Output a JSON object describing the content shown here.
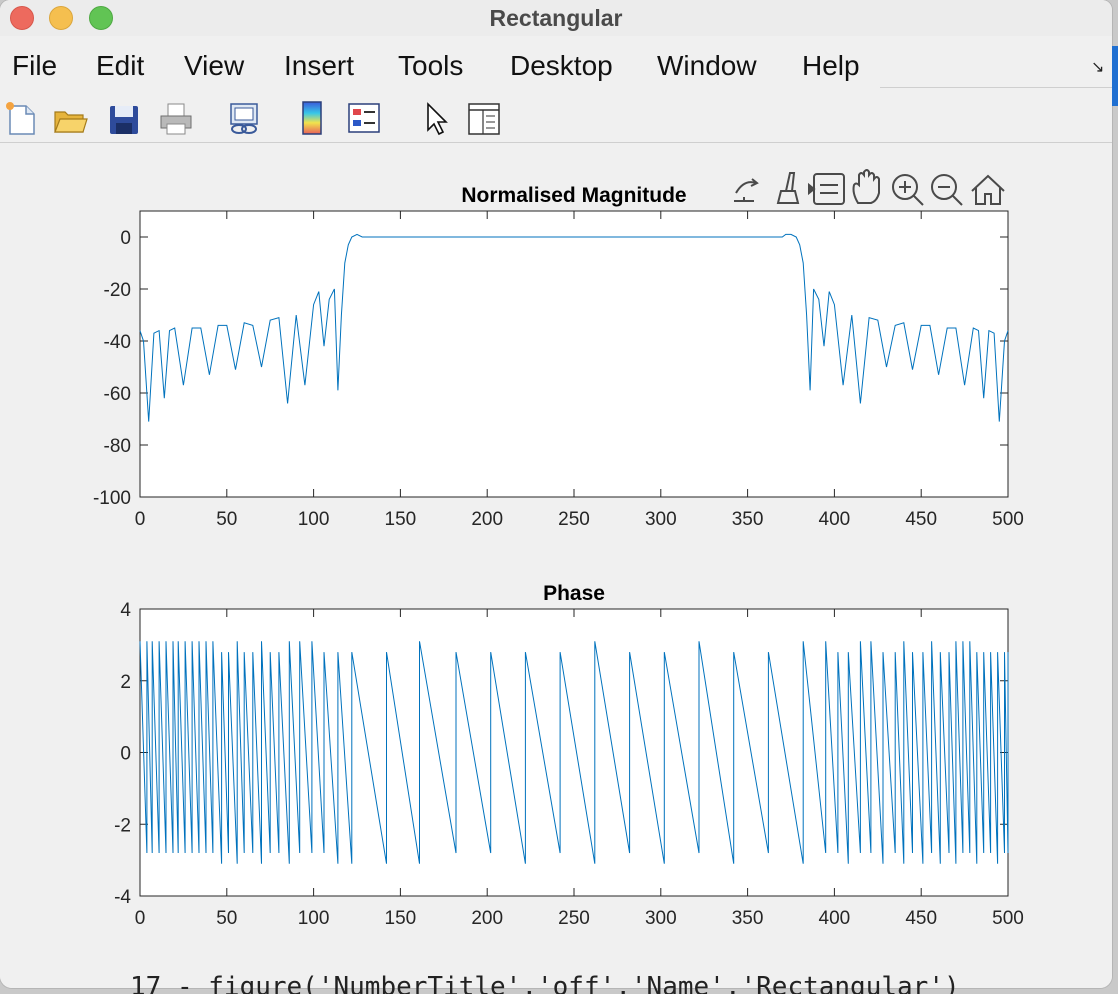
{
  "window": {
    "title": "Rectangular"
  },
  "menubar": {
    "items": [
      "File",
      "Edit",
      "View",
      "Insert",
      "Tools",
      "Desktop",
      "Window",
      "Help"
    ]
  },
  "toolbar": {
    "buttons": [
      "new-figure-icon",
      "open-file-icon",
      "save-icon",
      "print-icon",
      "link-plot-icon",
      "colorbar-icon",
      "legend-icon",
      "pointer-icon",
      "property-inspector-icon"
    ]
  },
  "axes_toolbar": {
    "buttons": [
      "export-icon",
      "brush-icon",
      "data-tips-icon",
      "pan-icon",
      "zoom-in-icon",
      "zoom-out-icon",
      "home-icon"
    ]
  },
  "background_code": "17 - figure('NumberTitle','off','Name','Rectangular')",
  "colors": {
    "line": "#0072bd"
  },
  "chart_data": [
    {
      "type": "line",
      "title": "Normalised Magnitude",
      "xlabel": "",
      "ylabel": "",
      "xlim": [
        0,
        500
      ],
      "ylim": [
        -100,
        10
      ],
      "xticks": [
        0,
        50,
        100,
        150,
        200,
        250,
        300,
        350,
        400,
        450,
        500
      ],
      "yticks": [
        0,
        -20,
        -40,
        -60,
        -80,
        -100
      ],
      "grid": false,
      "series": [
        {
          "description_of_shape": "",
          "x": [
            0,
            2,
            5,
            8,
            11,
            14,
            17,
            20,
            25,
            30,
            35,
            40,
            45,
            50,
            55,
            60,
            65,
            70,
            75,
            80,
            85,
            90,
            95,
            100,
            103,
            106,
            109,
            112,
            114,
            116,
            118,
            120,
            122,
            125,
            128,
            130,
            133,
            140,
            150,
            160,
            170,
            180,
            200,
            220,
            240,
            260,
            280,
            300,
            320,
            340,
            360,
            367,
            370,
            372,
            375,
            378,
            380,
            382,
            384,
            386,
            388,
            391,
            394,
            397,
            400,
            405,
            410,
            415,
            420,
            425,
            430,
            435,
            440,
            445,
            450,
            455,
            460,
            465,
            470,
            475,
            480,
            483,
            486,
            489,
            492,
            495,
            498,
            500
          ],
          "y": [
            -36,
            -40,
            -71,
            -37,
            -36,
            -62,
            -36,
            -35,
            -57,
            -35,
            -35,
            -53,
            -34,
            -34,
            -51,
            -33,
            -34,
            -50,
            -32,
            -31,
            -64,
            -30,
            -57,
            -26,
            -21,
            -42,
            -24,
            -20,
            -59,
            -30,
            -10,
            -3,
            0,
            1,
            0,
            0,
            0,
            0,
            0,
            0,
            0,
            0,
            0,
            0,
            0,
            0,
            0,
            0,
            0,
            0,
            0,
            0,
            0,
            1,
            1,
            0,
            -3,
            -10,
            -30,
            -59,
            -20,
            -24,
            -42,
            -21,
            -26,
            -57,
            -30,
            -64,
            -31,
            -32,
            -50,
            -34,
            -33,
            -51,
            -34,
            -34,
            -53,
            -35,
            -35,
            -57,
            -35,
            -36,
            -62,
            -36,
            -37,
            -71,
            -40,
            -36
          ]
        }
      ]
    },
    {
      "type": "line",
      "title": "Phase",
      "xlabel": "",
      "ylabel": "",
      "xlim": [
        0,
        500
      ],
      "ylim": [
        -4,
        4
      ],
      "xticks": [
        0,
        50,
        100,
        150,
        200,
        250,
        300,
        350,
        400,
        450,
        500
      ],
      "yticks": [
        4,
        2,
        0,
        -2,
        -4
      ],
      "grid": false,
      "series": [
        {
          "x": [
            0,
            4,
            7,
            11,
            15,
            19,
            22,
            26,
            30,
            34,
            38,
            42,
            47,
            51,
            56,
            60,
            65,
            70,
            75,
            80,
            86,
            92,
            99,
            106,
            114,
            122,
            142,
            161,
            182,
            202,
            222,
            242,
            262,
            282,
            302,
            322,
            342,
            362,
            382,
            395,
            402,
            408,
            415,
            421,
            428,
            435,
            440,
            445,
            451,
            456,
            461,
            466,
            470,
            474,
            478,
            482,
            486,
            490,
            494,
            498,
            500
          ],
          "top": [
            3.1,
            3.1,
            3.1,
            3.1,
            3.1,
            3.1,
            3.1,
            3.1,
            3.1,
            3.1,
            3.1,
            3.1,
            2.8,
            2.8,
            3.1,
            2.8,
            2.8,
            3.1,
            2.8,
            2.8,
            3.1,
            3.1,
            3.1,
            2.8,
            2.8,
            2.8,
            2.8,
            3.1,
            2.8,
            2.8,
            2.8,
            2.8,
            3.1,
            2.8,
            2.8,
            3.1,
            2.8,
            2.8,
            3.1,
            3.1,
            2.8,
            2.8,
            3.1,
            3.1,
            2.8,
            2.8,
            3.1,
            2.8,
            2.8,
            3.1,
            2.8,
            2.8,
            3.1,
            3.1,
            3.1,
            2.8,
            2.8,
            2.8,
            2.8,
            2.8,
            2.8
          ],
          "bottom": [
            -2.8,
            -2.8,
            -2.8,
            -2.8,
            -2.8,
            -2.8,
            -2.8,
            -2.8,
            -2.8,
            -2.8,
            -2.8,
            -3.1,
            -2.8,
            -3.1,
            -2.8,
            -2.8,
            -3.1,
            -2.8,
            -2.8,
            -3.1,
            -2.8,
            -2.8,
            -2.8,
            -3.1,
            -3.1,
            -3.1,
            -3.1,
            -2.8,
            -2.8,
            -3.1,
            -2.8,
            -3.1,
            -2.8,
            -3.1,
            -2.8,
            -3.1,
            -2.8,
            -3.1,
            -2.8,
            -2.8,
            -3.1,
            -2.8,
            -2.8,
            -3.1,
            -2.8,
            -3.1,
            -2.8,
            -3.1,
            -2.8,
            -3.1,
            -2.8,
            -3.1,
            -2.8,
            -2.8,
            -3.1,
            -2.8,
            -2.8,
            -3.1,
            -2.8,
            -2.8,
            -2.8
          ]
        }
      ]
    }
  ]
}
